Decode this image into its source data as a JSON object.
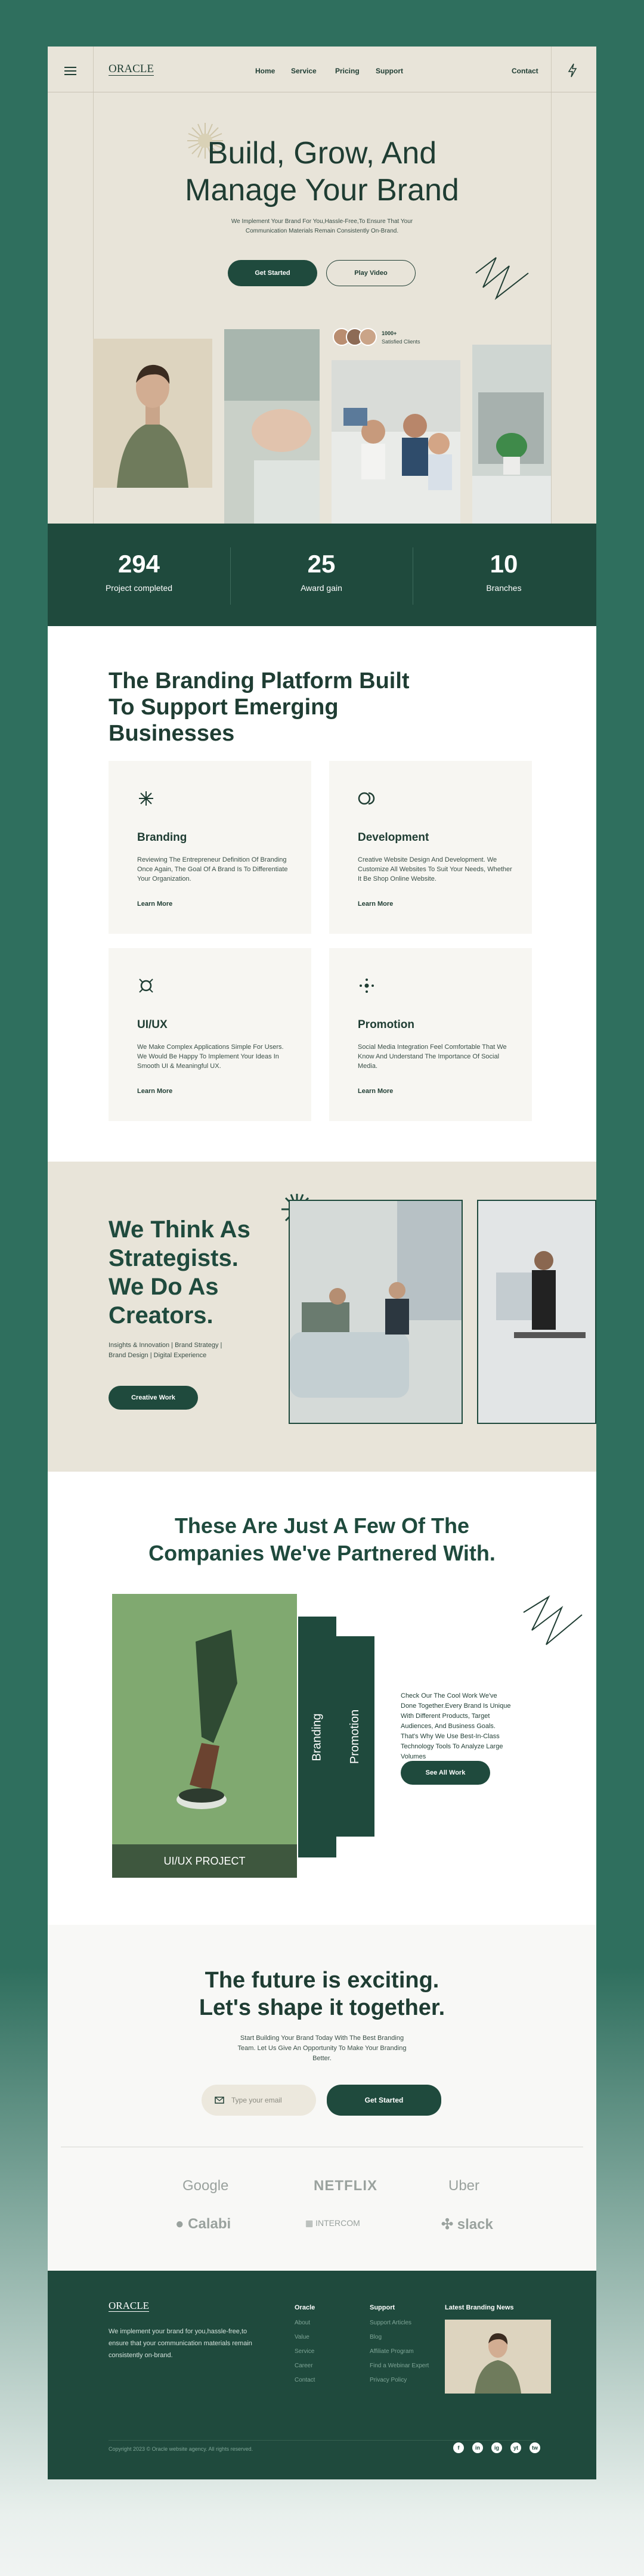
{
  "header": {
    "logo": "ORACLE",
    "nav": [
      "Home",
      "Service",
      "Pricing",
      "Support"
    ],
    "contact": "Contact"
  },
  "hero": {
    "title_line1": "Build, Grow, And",
    "title_line2": "Manage Your Brand",
    "subtitle": "We Implement Your Brand For You,Hassle-Free,To Ensure That Your Communication Materials Remain Consistently On-Brand.",
    "primary_btn": "Get Started",
    "secondary_btn": "Play Video",
    "clients_count": "1000+",
    "clients_label": "Satisfied Clients"
  },
  "stats": [
    {
      "value": "294",
      "label": "Project completed"
    },
    {
      "value": "25",
      "label": "Award gain"
    },
    {
      "value": "10",
      "label": "Branches"
    }
  ],
  "services": {
    "title_line1": "The Branding Platform Built",
    "title_line2": "To Support Emerging",
    "title_line3": "Businesses",
    "items": [
      {
        "icon": "asterisk-icon",
        "title": "Branding",
        "desc": "Reviewing The Entrepreneur Definition Of Branding Once Again, The Goal Of A Brand Is To Differentiate Your Organization.",
        "more": "Learn More"
      },
      {
        "icon": "toggle-icon",
        "title": "Development",
        "desc": "Creative Website Design And Development. We Customize All Websites To Suit Your Needs, Whether It Be Shop Online Website.",
        "more": "Learn More"
      },
      {
        "icon": "frame-icon",
        "title": "UI/UX",
        "desc": "We Make Complex Applications Simple For Users. We Would Be Happy To Implement Your Ideas In Smooth UI & Meaningful UX.",
        "more": "Learn More"
      },
      {
        "icon": "dots-icon",
        "title": "Promotion",
        "desc": "Social Media Integration Feel Comfortable That We Know And Understand The Importance Of Social Media.",
        "more": "Learn More"
      }
    ]
  },
  "strategists": {
    "line1": "We Think As",
    "line2": "Strategists.",
    "line3": "We Do As",
    "line4": "Creators.",
    "sub_line1": "Insights & Innovation | Brand Strategy |",
    "sub_line2": "Brand Design | Digital Experience",
    "button": "Creative Work"
  },
  "partners": {
    "title_line1": "These Are Just A Few Of The",
    "title_line2": "Companies We've Partnered With.",
    "project_label": "UI/UX PROJECT",
    "tab1": "Branding",
    "tab2": "Promotion",
    "desc": "Check Our The Cool Work We've Done Together.Every Brand Is Unique With Different Products, Target Audiences, And Business Goals. That's Why We Use Best-In-Class Technology Tools To Analyze Large Volumes",
    "button": "See All Work"
  },
  "future": {
    "title_line1": "The future is exciting.",
    "title_line2": "Let's shape it together.",
    "subtitle": "Start Building Your Brand Today With The Best Branding Team. Let Us Give An Opportunity To Make Your Branding Better.",
    "email_placeholder": "Type your email",
    "button": "Get Started",
    "logos": [
      "Google",
      "NETFLIX",
      "Uber",
      "Calabi",
      "INTERCOM",
      "slack"
    ]
  },
  "footer": {
    "logo": "ORACLE",
    "about": "We implement your brand for you,hassle-free,to ensure that your communication materials remain consistently on-brand.",
    "col1_title": "Oracle",
    "col1_items": [
      "About",
      "Value",
      "Service",
      "Career",
      "Contact"
    ],
    "col2_title": "Support",
    "col2_items": [
      "Support Articles",
      "Blog",
      "Affiliate Program",
      "Find a Webinar Expert",
      "Privacy Policy"
    ],
    "col3_title": "Latest Branding News",
    "copyright": "Copyright 2023 © Oracle website agency. All rights reserved.",
    "socials": [
      "f",
      "in",
      "ig",
      "yt",
      "tw"
    ]
  },
  "colors": {
    "primary": "#1f4a3d",
    "cream": "#e8e4d9",
    "background": "#2f6f5e"
  }
}
